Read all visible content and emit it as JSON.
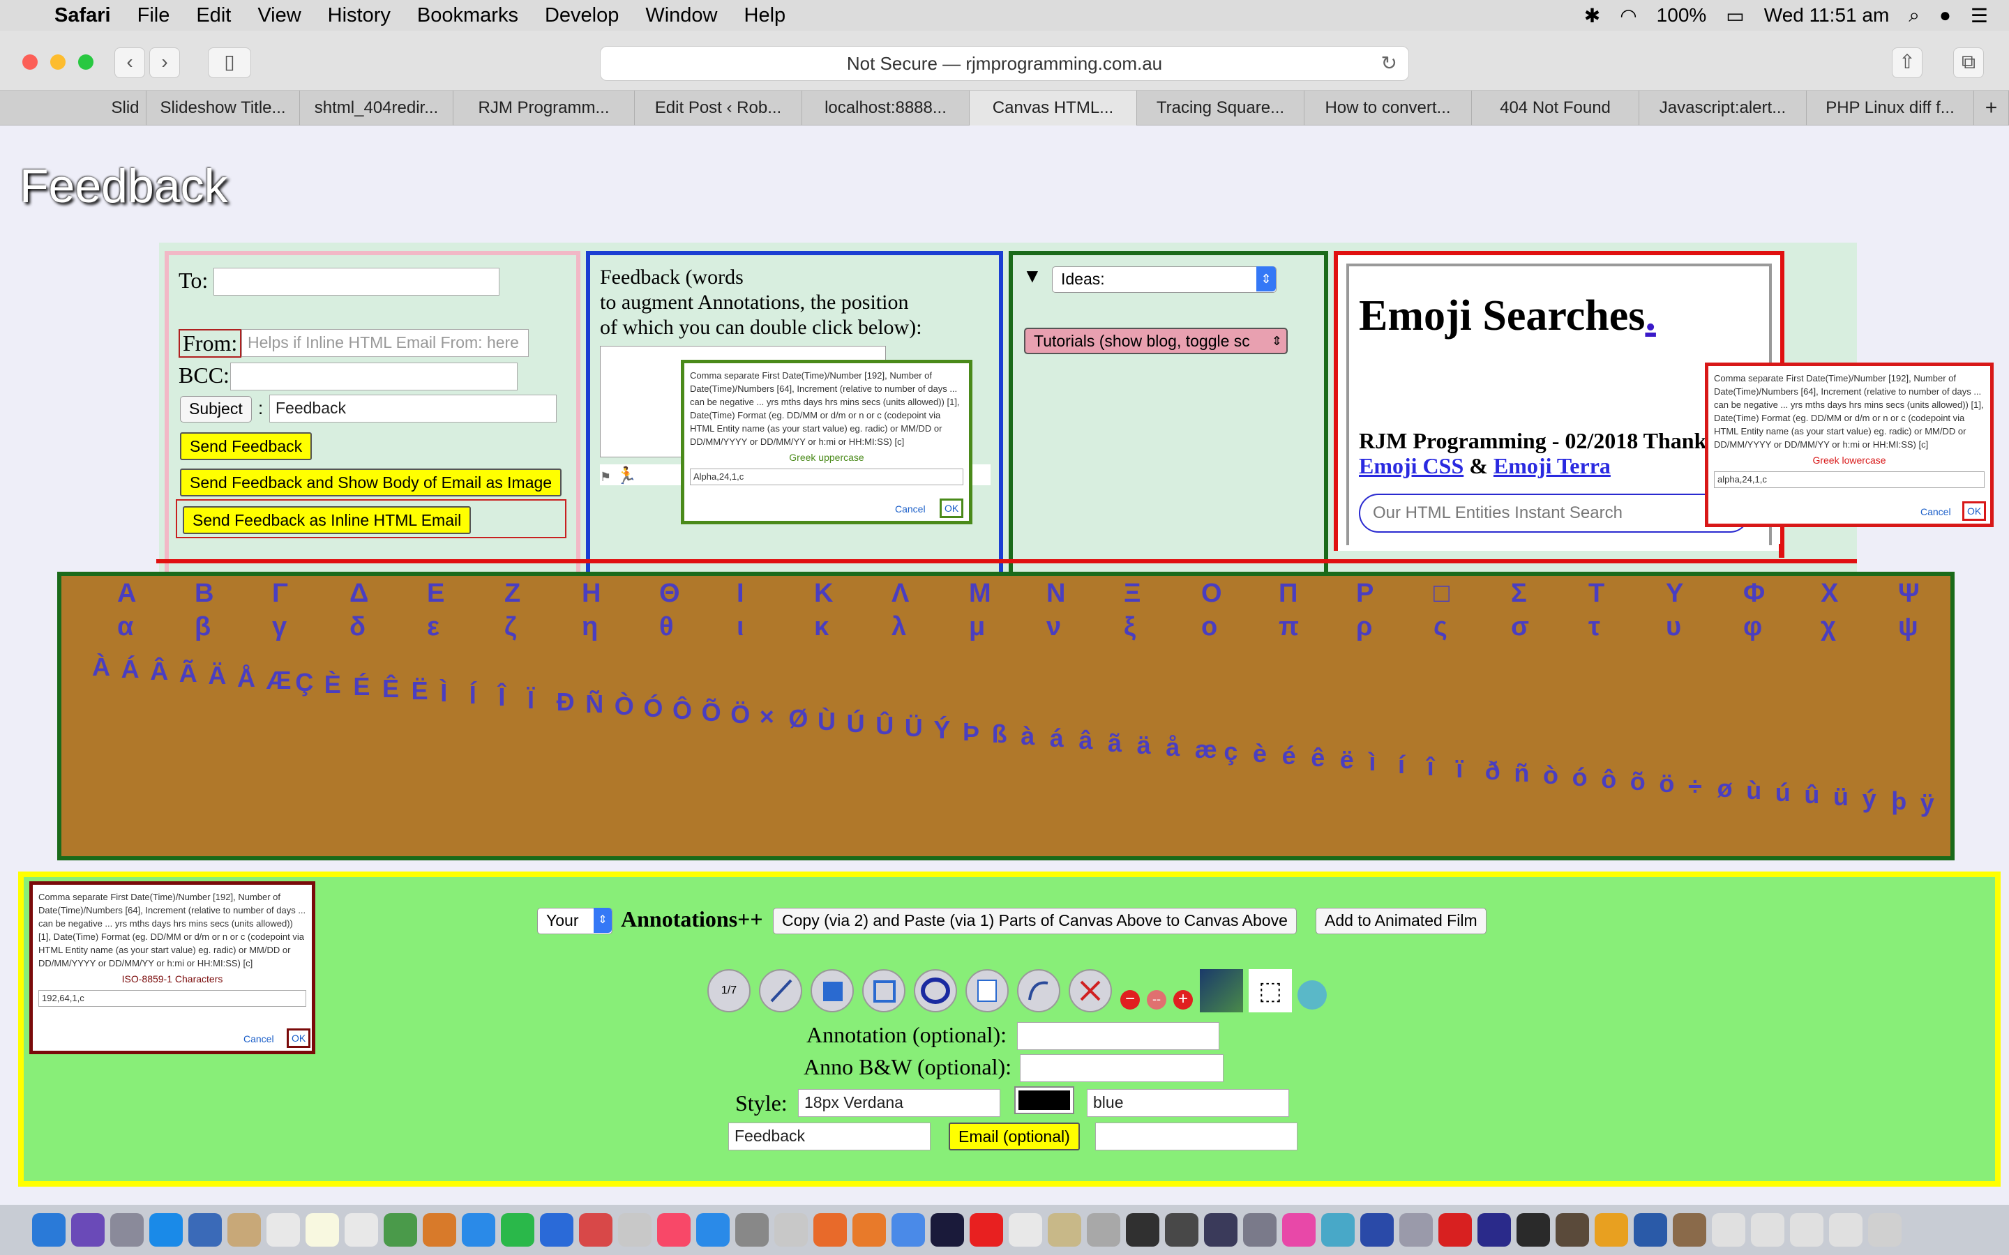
{
  "menubar": {
    "app": "Safari",
    "items": [
      "File",
      "Edit",
      "View",
      "History",
      "Bookmarks",
      "Develop",
      "Window",
      "Help"
    ],
    "battery": "100%",
    "clock": "Wed 11:51 am"
  },
  "toolbar": {
    "url": "Not Secure — rjmprogramming.com.au"
  },
  "tabs": [
    "Slid",
    "Slideshow Title...",
    "shtml_404redir...",
    "RJM Programm...",
    "Edit Post ‹ Rob...",
    "localhost:8888...",
    "Canvas HTML...",
    "Tracing Square...",
    "How to convert...",
    "404 Not Found",
    "Javascript:alert...",
    "PHP Linux diff f..."
  ],
  "page": {
    "title": "Feedback"
  },
  "email_form": {
    "to_label": "To:",
    "from_label": "From:",
    "from_placeholder": "Helps if Inline HTML Email From: here",
    "bcc_label": "BCC:",
    "subject_button": "Subject",
    "subject_sep": ":",
    "subject_value": "Feedback",
    "send": "Send Feedback",
    "send_image": "Send Feedback and Show Body of Email as Image",
    "send_inline": "Send Feedback as Inline HTML Email"
  },
  "feedback_words": {
    "line1": "Feedback (words",
    "line2": "to augment Annotations, the position",
    "line3": "of which you can double click below):"
  },
  "ideas": {
    "toggle": "▼",
    "select": "Ideas:",
    "tutorials": "Tutorials (show blog, toggle sc"
  },
  "emoji": {
    "heading": "Emoji Searches",
    "dot": ".",
    "thanks": "RJM Programming - 02/2018 Thank",
    "css_link": "Emoji CSS",
    "amp": "&",
    "terra_link": "Emoji Terra",
    "search_placeholder": "Our HTML Entities Instant Search"
  },
  "dialogs": [
    {
      "text": "Comma separate First Date(Time)/Number [192], Number of Date(Time)/Numbers [64], Increment (relative to number of days ... can be negative ... yrs mths days hrs mins secs (units allowed)) [1], Date(Time) Format (eg. DD/MM or d/m or n or c (codepoint via HTML Entity name (as your start value) eg. radic) or MM/DD or DD/MM/YYYY or DD/MM/YY or h:mi or HH:MI:SS) [c]",
      "title": "Greek uppercase",
      "value": "Alpha,24,1,c",
      "cancel": "Cancel",
      "ok": "OK",
      "color": "#5a8a1a"
    },
    {
      "text": "Comma separate First Date(Time)/Number [192], Number of Date(Time)/Numbers [64], Increment (relative to number of days ... can be negative ... yrs mths days hrs mins secs (units allowed)) [1], Date(Time) Format (eg. DD/MM or d/m or n or c (codepoint via HTML Entity name (as your start value) eg. radic) or MM/DD or DD/MM/YYYY or DD/MM/YY or h:mi or HH:MI:SS) [c]",
      "title": "Greek lowercase",
      "value": "alpha,24,1,c",
      "cancel": "Cancel",
      "ok": "OK",
      "color": "#d81818"
    },
    {
      "text": "Comma separate First Date(Time)/Number [192], Number of Date(Time)/Numbers [64], Increment (relative to number of days ... can be negative ... yrs mths days hrs mins secs (units allowed)) [1], Date(Time) Format (eg. DD/MM or d/m or n or c (codepoint via HTML Entity name (as your start value) eg. radic) or MM/DD or DD/MM/YYYY or DD/MM/YY or h:mi or HH:MI:SS) [c]",
      "title": "ISO-8859-1 Characters",
      "value": "192,64,1,c",
      "cancel": "Cancel",
      "ok": "OK",
      "color": "#7a0a0a"
    }
  ],
  "canvas": {
    "greek_upper": [
      "Α",
      "Β",
      "Γ",
      "Δ",
      "Ε",
      "Ζ",
      "Η",
      "Θ",
      "Ι",
      "Κ",
      "Λ",
      "Μ",
      "Ν",
      "Ξ",
      "Ο",
      "Π",
      "Ρ",
      "□",
      "Σ",
      "Τ",
      "Υ",
      "Φ",
      "Χ",
      "Ψ"
    ],
    "greek_lower": [
      "α",
      "β",
      "γ",
      "δ",
      "ε",
      "ζ",
      "η",
      "θ",
      "ι",
      "κ",
      "λ",
      "μ",
      "ν",
      "ξ",
      "ο",
      "π",
      "ρ",
      "ς",
      "σ",
      "τ",
      "υ",
      "φ",
      "χ",
      "ψ"
    ],
    "latin1": "ÀÁÂÃÄÅÆÇÈÉÊËÌÍÎÏÐÑÒÓÔÕÖ×ØÙÚÛÜÝÞßàáâãäåæçèéêëìíîïðñòóôõö÷øùúûüýþÿ",
    "bg": "#b0782a"
  },
  "annotation_panel": {
    "your": "Your",
    "heading": "Annotations++",
    "copy_paste": "Copy (via 2) and Paste (via 1) Parts of Canvas Above to Canvas Above",
    "animated": "Add to Animated Film",
    "annotation_label": "Annotation (optional):",
    "anno_bw_label": "Anno B&W (optional):",
    "style_label": "Style:",
    "font_value": "18px Verdana",
    "color_value": "blue",
    "feedback_value": "Feedback",
    "email_button": "Email (optional)"
  },
  "tools": [
    "calendar-tool-icon",
    "line-tool-icon",
    "filled-rect-icon",
    "rect-icon",
    "ellipse-icon",
    "blank-rect-icon",
    "curve-icon",
    "erase-icon",
    "minus-icon",
    "dashes-icon",
    "plus-icon",
    "image-icon",
    "cursor-select-icon",
    "camera-icon"
  ]
}
